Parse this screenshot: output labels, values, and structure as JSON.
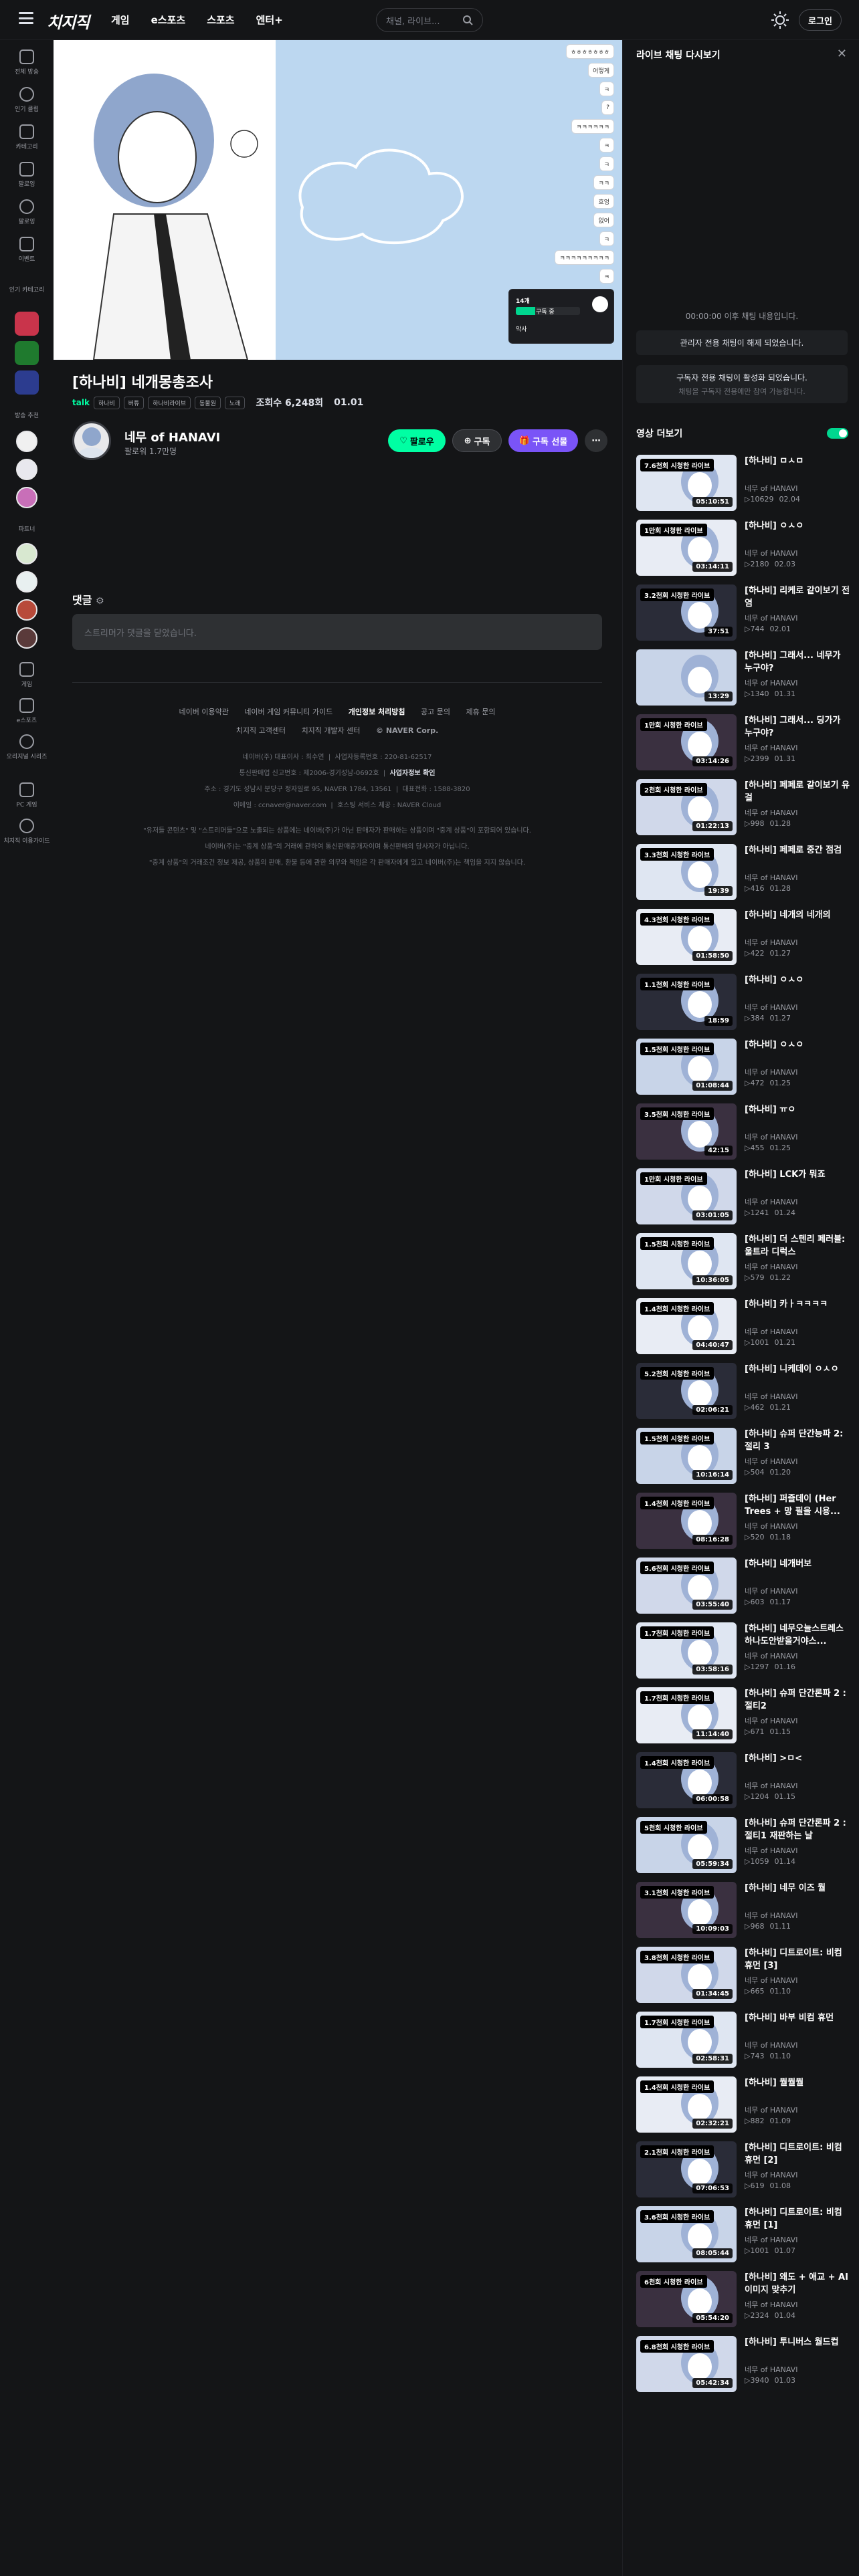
{
  "header": {
    "logo": "치지직",
    "nav": [
      "게임",
      "e스포츠",
      "스포츠",
      "엔터+"
    ],
    "search_placeholder": "채널, 라이브...",
    "login": "로그인"
  },
  "sidebar": {
    "items": [
      {
        "label": "전체 방송",
        "icon": "broadcast-icon"
      },
      {
        "label": "인기 클립",
        "icon": "clip-icon"
      },
      {
        "label": "카테고리",
        "icon": "category-icon"
      },
      {
        "label": "팔로잉",
        "icon": "following-icon"
      },
      {
        "label": "팔로잉",
        "icon": "heart-icon"
      },
      {
        "label": "이벤트",
        "icon": "event-icon"
      }
    ],
    "popular_categories": "인기 카테고리",
    "recommended": "방송 추천",
    "partners": "파트너",
    "bottom": [
      {
        "label": "게임",
        "icon": "game-icon"
      },
      {
        "label": "e스포츠",
        "icon": "trophy-icon"
      },
      {
        "label": "오리지널 시리즈",
        "icon": "original-icon"
      },
      {
        "label": "PC 게임",
        "icon": "pc-icon"
      },
      {
        "label": "치지직 이용가이드",
        "icon": "guide-icon"
      }
    ]
  },
  "player": {
    "chat_bubbles": [
      "ㅎㅎㅎㅎㅎㅎㅎ",
      "어떻게",
      "ㅋ",
      "?",
      "ㅋㅋㅋㅋㅋㅋ",
      "ㅋ",
      "ㅋ",
      "ㅋㅋ",
      "흐엉",
      "없어",
      "ㅋ",
      "ㅋㅋㅋㅋㅋㅋㅋㅋㅋ",
      "ㅋ"
    ],
    "overlay_line1": "14개",
    "overlay_line2": "구독 중",
    "overlay_line3": "악사"
  },
  "video": {
    "title": "[하나비] 네개몽총조사",
    "talk": "talk",
    "tags": [
      "하나비",
      "버튜",
      "하나비라이브",
      "동물원",
      "노래"
    ],
    "views_label": "조회수 6,248회",
    "date": "01.01"
  },
  "channel": {
    "name": "네무 of HANAVI",
    "followers": "팔로워 1.7만명",
    "follow_btn": "팔로우",
    "subscribe_btn": "구독",
    "gift_btn": "구독 선물",
    "more": "⋯"
  },
  "comments": {
    "heading": "댓글",
    "placeholder": "스트리머가 댓글을 닫았습니다."
  },
  "footer": {
    "links": [
      "네이버 이용약관",
      "네이버 게임 커뮤니티 가이드",
      "개인정보 처리방침",
      "공고 문의",
      "제휴 문의"
    ],
    "links2": [
      "치지직 고객센터",
      "치지직 개발자 센터",
      "© NAVER Corp."
    ],
    "company": [
      "네이버(주) 대표이사 : 최수연",
      "사업자등록번호 : 220-81-62517"
    ],
    "company2": [
      "통신판매업 신고번호 : 제2006-경기성남-0692호",
      "사업자정보 확인"
    ],
    "company3": [
      "주소 : 경기도 성남시 분당구 정자일로 95, NAVER 1784, 13561",
      "대표전화 : 1588-3820"
    ],
    "company4": [
      "이메일 : ccnaver@naver.com",
      "호스팅 서비스 제공 : NAVER Cloud"
    ],
    "notice1": "\"유저들 콘텐츠\" 및 \"스트리머들\"으로 노출되는 상품에는 네이버(주)가 아닌 판매자가 판매하는 상품이며 \"중계 상품\"이 포함되어 있습니다.",
    "notice2": "네이버(주)는 \"중계 상품\"의 거래에 관하여 통신판매중개자이며 통신판매의 당사자가 아닙니다.",
    "notice3": "\"중계 상품\"의 거래조건 정보 제공, 상품의 판매, 환불 등에 관한 의무와 책임은 각 판매자에게 있고 네이버(주)는 책임을 지지 않습니다."
  },
  "chat_panel": {
    "title": "라이브 채팅 다시보기",
    "close": "✕",
    "info": "00:00:00 이후 채팅 내용입니다.",
    "admin_only": "관리자 전용 채팅이 해제 되었습니다.",
    "sub_only": "구독자 전용 채팅이 활성화 되었습니다.",
    "sub_only_sub": "채팅을 구독자 전용에만 참여 가능합니다."
  },
  "more_videos": {
    "heading": "영상 더보기",
    "channel": "네무 of HANAVI",
    "items": [
      {
        "badge": "7.6천회 시청한 라이브",
        "duration": "05:10:51",
        "title": "[하나비] ㅁㅅㅁ",
        "views": "10629",
        "date": "02.04"
      },
      {
        "badge": "1만회 시청한 라이브",
        "duration": "03:14:11",
        "title": "[하나비] ㅇㅅㅇ",
        "views": "2180",
        "date": "02.03"
      },
      {
        "badge": "3.2천회 시청한 라이브",
        "duration": "37:51",
        "title": "[하나비] 리케로 같이보기 전염",
        "views": "744",
        "date": "02.01"
      },
      {
        "badge": "",
        "duration": "13:29",
        "title": "[하나비] 그래서... 네무가 누구야?",
        "views": "1340",
        "date": "01.31"
      },
      {
        "badge": "1만회 시청한 라이브",
        "duration": "03:14:26",
        "title": "[하나비] 그래서... 딩가가 누구야?",
        "views": "2399",
        "date": "01.31"
      },
      {
        "badge": "2천회 시청한 라이브",
        "duration": "01:22:13",
        "title": "[하나비] 페페로 같이보기 유걸",
        "views": "998",
        "date": "01.28"
      },
      {
        "badge": "3.3천회 시청한 라이브",
        "duration": "19:39",
        "title": "[하나비] 페페로 중간 점검",
        "views": "416",
        "date": "01.28"
      },
      {
        "badge": "4.3천회 시청한 라이브",
        "duration": "01:58:50",
        "title": "[하나비] 네개의 네개의",
        "views": "422",
        "date": "01.27"
      },
      {
        "badge": "1.1천회 시청한 라이브",
        "duration": "18:59",
        "title": "[하나비] ㅇㅅㅇ",
        "views": "384",
        "date": "01.27"
      },
      {
        "badge": "1.5천회 시청한 라이브",
        "duration": "01:08:44",
        "title": "[하나비] ㅇㅅㅇ",
        "views": "472",
        "date": "01.25"
      },
      {
        "badge": "3.5천회 시청한 라이브",
        "duration": "42:15",
        "title": "[하나비] ㅠㅇ",
        "views": "455",
        "date": "01.25"
      },
      {
        "badge": "1만회 시청한 라이브",
        "duration": "03:01:05",
        "title": "[하나비] LCK가 뭐죠",
        "views": "1241",
        "date": "01.24"
      },
      {
        "badge": "1.5천회 시청한 라이브",
        "duration": "10:36:05",
        "title": "[하나비] 더 스텐리 페러블: 울트라 디럭스",
        "views": "579",
        "date": "01.22"
      },
      {
        "badge": "1.4천회 시청한 라이브",
        "duration": "04:40:47",
        "title": "[하나비] 카ㅏㅋㅋㅋㅋ",
        "views": "1001",
        "date": "01.21"
      },
      {
        "badge": "5.2천회 시청한 라이브",
        "duration": "02:06:21",
        "title": "[하나비] 니케데이 ㅇㅅㅇ",
        "views": "462",
        "date": "01.21"
      },
      {
        "badge": "1.5천회 시청한 라이브",
        "duration": "10:16:14",
        "title": "[하나비] 슈퍼 단간능파 2: 절리 3",
        "views": "504",
        "date": "01.20"
      },
      {
        "badge": "1.4천회 시청한 라이브",
        "duration": "08:16:28",
        "title": "[하나비] 퍼즐데이 (Her Trees + 망 필을 시용...",
        "views": "520",
        "date": "01.18"
      },
      {
        "badge": "5.6천회 시청한 라이브",
        "duration": "03:55:40",
        "title": "[하나비] 네개버보",
        "views": "603",
        "date": "01.17"
      },
      {
        "badge": "1.7천회 시청한 라이브",
        "duration": "03:58:16",
        "title": "[하나비] 네무오늘스트레스하나도안받을거야스...",
        "views": "1297",
        "date": "01.16"
      },
      {
        "badge": "1.7천회 시청한 라이브",
        "duration": "11:14:40",
        "title": "[하나비] 슈퍼 단간론파 2 : 절티2",
        "views": "671",
        "date": "01.15"
      },
      {
        "badge": "1.4천회 시청한 라이브",
        "duration": "06:00:58",
        "title": "[하나비] >ㅁ<",
        "views": "1204",
        "date": "01.15"
      },
      {
        "badge": "5천회 시청한 라이브",
        "duration": "05:59:34",
        "title": "[하나비] 슈퍼 단간론파 2 : 절티1 재판하는 날",
        "views": "1059",
        "date": "01.14"
      },
      {
        "badge": "3.1천회 시청한 라이브",
        "duration": "10:09:03",
        "title": "[하나비] 네무 이즈 뭘",
        "views": "968",
        "date": "01.11"
      },
      {
        "badge": "3.8천회 시청한 라이브",
        "duration": "01:34:45",
        "title": "[하나비] 디트로이트: 비컴 휴먼 [3]",
        "views": "665",
        "date": "01.10"
      },
      {
        "badge": "1.7천회 시청한 라이브",
        "duration": "02:58:31",
        "title": "[하나비] 바부 비컴 휴먼",
        "views": "743",
        "date": "01.10"
      },
      {
        "badge": "1.4천회 시청한 라이브",
        "duration": "02:32:21",
        "title": "[하나비] 뭘뭘뭘",
        "views": "882",
        "date": "01.09"
      },
      {
        "badge": "2.1천회 시청한 라이브",
        "duration": "07:06:53",
        "title": "[하나비] 디트로이트: 비컴 휴먼 [2]",
        "views": "619",
        "date": "01.08"
      },
      {
        "badge": "3.6천회 시청한 라이브",
        "duration": "08:05:44",
        "title": "[하나비] 디트로이트: 비컴 휴먼 [1]",
        "views": "1001",
        "date": "01.07"
      },
      {
        "badge": "6천회 시청한 라이브",
        "duration": "05:54:20",
        "title": "[하나비] 왜도 + 애교 + AI 이미지 맞추기",
        "views": "2324",
        "date": "01.04"
      },
      {
        "badge": "6.8천회 시청한 라이브",
        "duration": "05:42:34",
        "title": "[하나비] 투니버스 월드컵",
        "views": "3940",
        "date": "01.03"
      }
    ]
  },
  "colors": {
    "accent": "#00ffa3",
    "subscribe": "#7a54f7",
    "bg": "#141517"
  }
}
